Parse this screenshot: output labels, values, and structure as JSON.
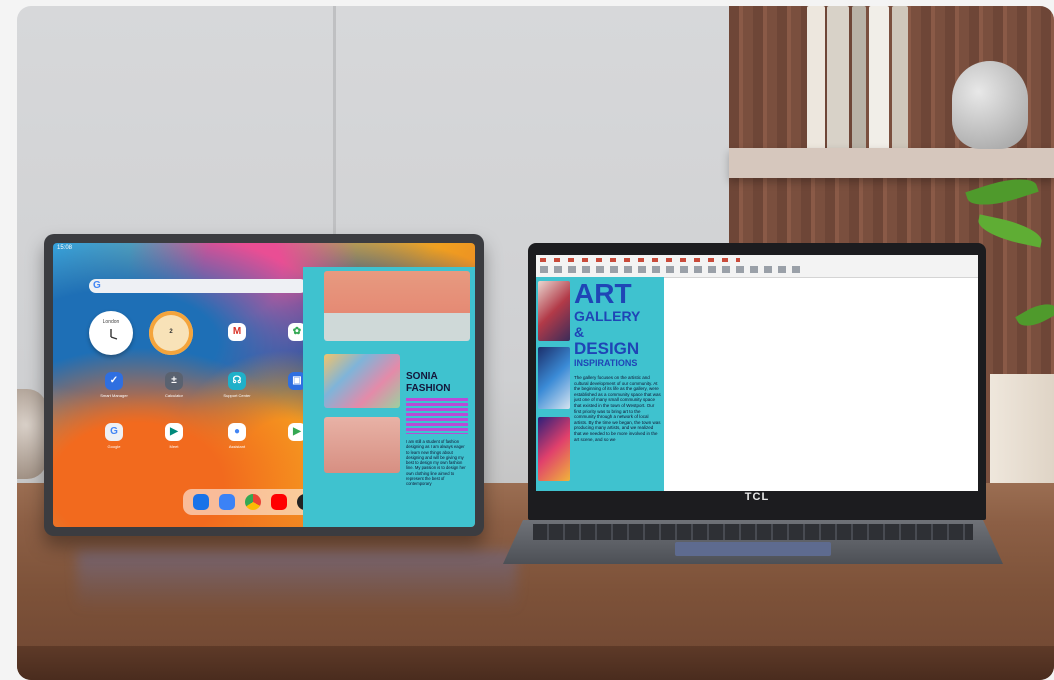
{
  "scene": {
    "colors": {
      "wall": "#d7d8da",
      "shelf_wood": "#7a4f3e",
      "desk": "#8c5f45",
      "panel_teal": "#3fc2cf",
      "art_title": "#1f45b6"
    }
  },
  "tablet": {
    "status_time": "15:08",
    "search_icon": "google-g-icon",
    "clock_city": "London",
    "weather_temp": "2",
    "apps": [
      {
        "label": "Smart Manager",
        "icon": "shield-icon"
      },
      {
        "label": "Calculator",
        "icon": "calculator-icon"
      },
      {
        "label": "Support Center",
        "icon": "headset-icon"
      },
      {
        "label": "Google",
        "icon": "google-folder-icon"
      },
      {
        "label": "Meet",
        "icon": "meet-icon"
      },
      {
        "label": "Assistant",
        "icon": "assistant-icon"
      }
    ],
    "panel": {
      "heading_line1": "SONIA",
      "heading_line2": "FASHION",
      "paragraph": "I am still a student of fashion designing as I am always eager to learn new things about designing and will be giving my best to design my own fashion line. My passion is to design her own clothing line aimed to represent the best of contemporary"
    }
  },
  "laptop": {
    "brand": "TCL",
    "document": {
      "title_art": "ART",
      "title_gallery": "GALLERY",
      "title_amp": "&",
      "title_design": "DESIGN",
      "title_inspirations": "INSPIRATIONS",
      "body": "The gallery focuses on the artistic and cultural development of our community. At the beginning of its life as the gallery, were established as a community space that was just one of many small community space that existed in the town of Westport. Our first priority was to bring art to the community through a network of local artists. By the time we began, the town was producing many artists, and we realized that we needed to be more involved in the art scene, and so we"
    }
  }
}
